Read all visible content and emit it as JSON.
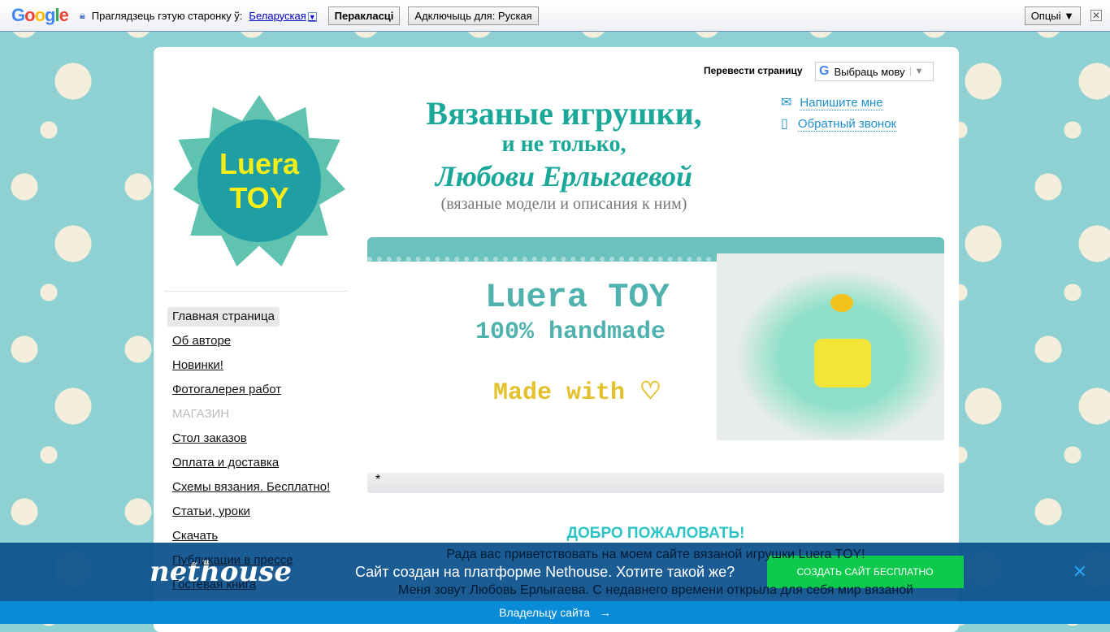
{
  "translate_bar": {
    "prompt": "Праглядзець гэтую старонку ў:",
    "language": "Беларуская",
    "translate": "Перакласці",
    "disable": "Адключыць для: Руская",
    "options": "Опцыі ▼",
    "google": "Google"
  },
  "header": {
    "translate_label": "Перевести страницу",
    "select_language": "Выбраць мову",
    "title1": "Вязаные игрушки,",
    "title2": "и не только,",
    "title3": "Любови Ерлыгаевой",
    "subtitle": "(вязаные модели и описания к ним)",
    "write_me": "Напишите мне",
    "callback": "Обратный звонок"
  },
  "logo": {
    "text1": "Luera",
    "text2": "TOY"
  },
  "menu": [
    {
      "label": "Главная страница"
    },
    {
      "label": "Об авторе"
    },
    {
      "label": "Новинки!"
    },
    {
      "label": "Фотогалерея работ"
    },
    {
      "label": "МАГАЗИН"
    },
    {
      "label": "Стол заказов"
    },
    {
      "label": "Оплата и доставка"
    },
    {
      "label": "Схемы вязания. Бесплатно!"
    },
    {
      "label": "Статьи, уроки"
    },
    {
      "label": "Скачать"
    },
    {
      "label": "Публикации в прессе"
    },
    {
      "label": "Гостевая книга"
    }
  ],
  "banner": {
    "line1": "Luera TOY",
    "line2": "100% handmade",
    "line3": "Made with ♡"
  },
  "bar_text": "*",
  "welcome": {
    "heading": "ДОБРО ПОЖАЛОВАТЬ!",
    "p1": "Рада вас приветствовать на моем сайте вязаной игрушки Luera TOY!",
    "p2": "Меня зовут Любовь Ерлыгаева. С недавнего времени открыла для себя мир вязаной"
  },
  "nethouse": {
    "logo": "nethouse",
    "text": "Сайт создан на платформе Nethouse. Хотите такой же?",
    "cta": "СОЗДАТЬ САЙТ БЕСПЛАТНО",
    "owner": "Владельцу сайта"
  },
  "colors": {
    "accent": "#1aa898",
    "cta": "#0ec94c",
    "nethouse": "#0c528c"
  }
}
